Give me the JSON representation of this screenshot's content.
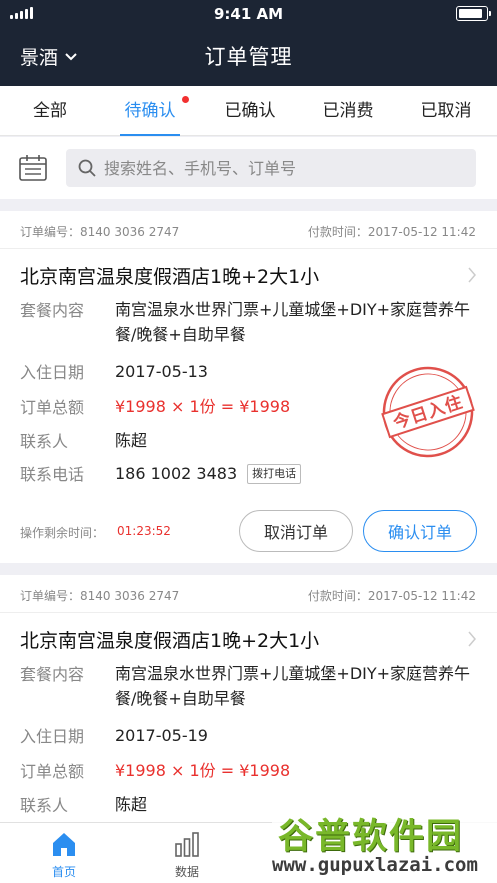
{
  "status_bar": {
    "time": "9:41 AM",
    "battery_level": 0.9
  },
  "header": {
    "scenic_selector": "景酒",
    "title": "订单管理"
  },
  "tabs": [
    {
      "label": "全部",
      "active": false,
      "badge": false
    },
    {
      "label": "待确认",
      "active": true,
      "badge": true
    },
    {
      "label": "已确认",
      "active": false,
      "badge": false
    },
    {
      "label": "已消费",
      "active": false,
      "badge": false
    },
    {
      "label": "已取消",
      "active": false,
      "badge": false
    }
  ],
  "search": {
    "placeholder": "搜索姓名、手机号、订单号"
  },
  "orders": [
    {
      "order_no": "订单编号：8140 3036 2747",
      "pay_time": "付款时间：2017-05-12 11:42",
      "hotel": "北京南宫温泉度假酒店1晚+2大1小",
      "package_label": "套餐内容",
      "package": "南宫温泉水世界门票+儿童城堡+DIY+家庭营养午餐/晚餐+自助早餐",
      "checkin_label": "入住日期",
      "checkin": "2017-05-13",
      "total_label": "订单总额",
      "total": "¥1998 × 1份 = ¥1998",
      "contact_label": "联系人",
      "contact": "陈超",
      "phone_label": "联系电话",
      "phone": "186 1002 3483",
      "call_button": "拨打电话",
      "stamp": "今日入住",
      "remain_label": "操作剩余时间：",
      "remain_time": "01:23:52",
      "cancel_button": "取消订单",
      "confirm_button": "确认订单"
    },
    {
      "order_no": "订单编号：8140 3036 2747",
      "pay_time": "付款时间：2017-05-12 11:42",
      "hotel": "北京南宫温泉度假酒店1晚+2大1小",
      "package_label": "套餐内容",
      "package": "南宫温泉水世界门票+儿童城堡+DIY+家庭营养午餐/晚餐+自助早餐",
      "checkin_label": "入住日期",
      "checkin": "2017-05-19",
      "total_label": "订单总额",
      "total": "¥1998 × 1份 = ¥1998",
      "contact_label": "联系人",
      "contact": "陈超"
    }
  ],
  "bottom_nav": [
    {
      "label": "首页",
      "icon": "home-icon",
      "active": true
    },
    {
      "label": "数据",
      "icon": "bar-chart-icon",
      "active": false
    }
  ],
  "watermark": {
    "title": "谷普软件园",
    "url": "www.gupuxlazai.com"
  },
  "colors": {
    "header_bg": "#1c2534",
    "accent": "#2b8ef0",
    "price_red": "#e9312e",
    "stamp_red": "#e0504b"
  }
}
